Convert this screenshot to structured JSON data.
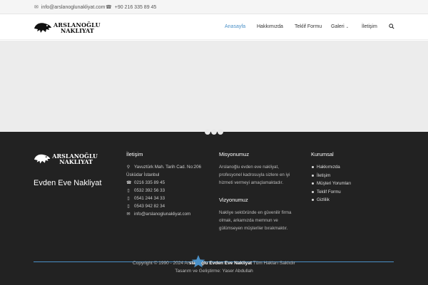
{
  "topbar": {
    "email": "info@arslanoglunakliyat.com",
    "phone": "+90 216 335 89 45"
  },
  "logo": {
    "line1": "ARSLANOĞLU",
    "line2": "NAKLIYAT"
  },
  "nav": {
    "items": [
      "Anasayfa",
      "Hakkımızda",
      "Teklif Formu",
      "Galeri",
      "İletişim"
    ],
    "active": "Anasayfa",
    "accent": "#4a90c7"
  },
  "footer": {
    "tagline": "Evden Eve Nakliyat",
    "contact": {
      "title": "İletişim",
      "address1": "Yavuztürk Mah. Tarih Cad. No:206",
      "address2": "Üsküdar İstanbul",
      "phones": [
        "0216 335 89 45",
        "0532 392 56 33",
        "0541 244 34 33",
        "0543 942 82 34"
      ],
      "email": "info@arslanoglunakliyat.com"
    },
    "mission": {
      "title": "Misyonumuz",
      "text": [
        "Arslanoğlu evden eve nakliyat,",
        "profesyonel kadrosuyla sizlere en iyi",
        "hizmeti vermeyi amaçlamaktadır."
      ]
    },
    "vision": {
      "title": "Vizyonumuz",
      "text": [
        "Nakliye sektöründe en güvenilir firma",
        "olmak, arkamızda memnun ve",
        "gülümseyen müşteriler bırakmaktır."
      ]
    },
    "corporate": {
      "title": "Kurumsal",
      "links": [
        "Hakkımızda",
        "İletişim",
        "Müşteri Yorumları",
        "Teklif Formu",
        "Gizlilik"
      ]
    },
    "copyright_pre": "Copyright © 1990 - 2024 Ar",
    "copyright_brand": "slanoğlu Evden Eve Nakliyat",
    "copyright_post": " Tüm Hakları Saklıdır",
    "credit": "Tasarım ve Geliştirme: Yaser Abdullah"
  }
}
